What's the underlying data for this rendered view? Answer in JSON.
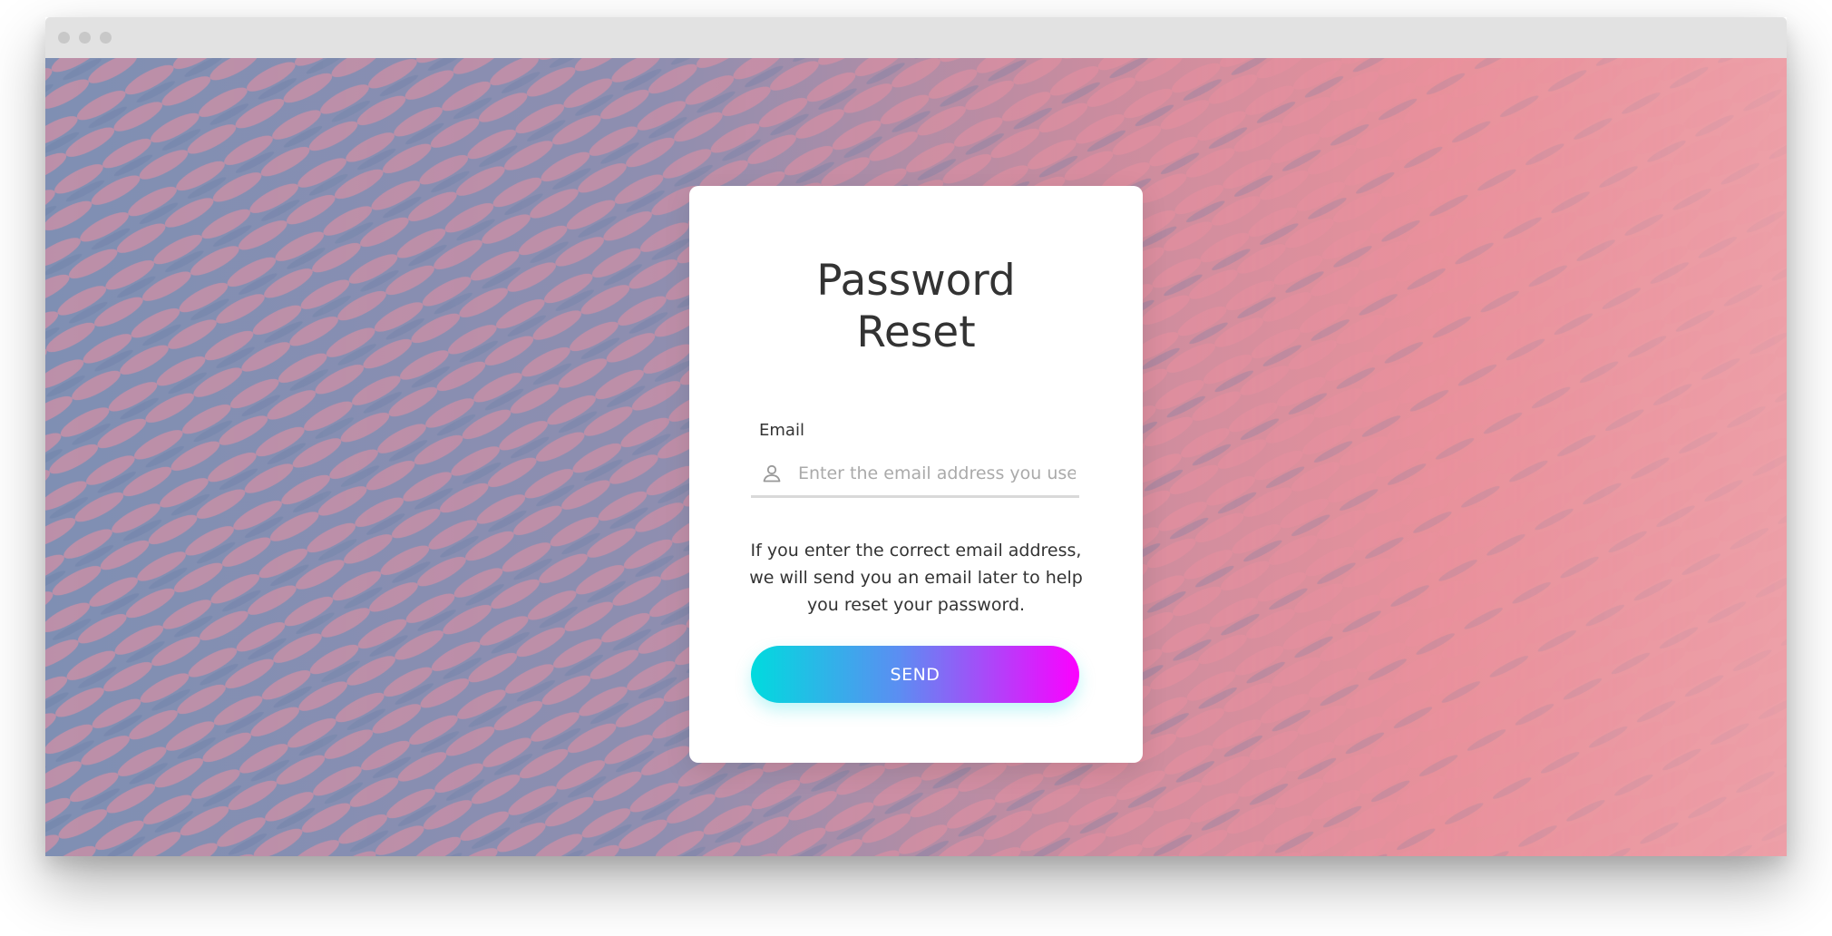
{
  "form": {
    "title_line1": "Password",
    "title_line2": "Reset",
    "email_label": "Email",
    "email_placeholder": "Enter the email address you used",
    "email_value": "",
    "help_text": "If you enter the correct email address, we will send you an email later to help you reset your password.",
    "send_label": "SEND"
  },
  "icons": {
    "input_icon": "user-icon"
  },
  "colors": {
    "button_gradient_start": "#00dbde",
    "button_gradient_end": "#fc00ff",
    "background_blue": "#7b8fb2",
    "background_pink": "#e9929e"
  }
}
